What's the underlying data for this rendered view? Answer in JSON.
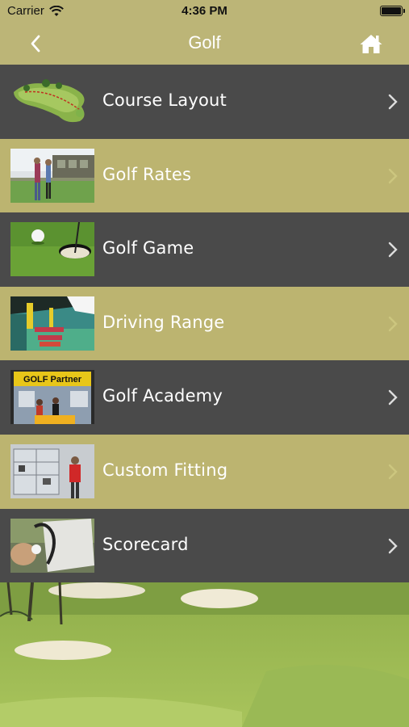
{
  "status_bar": {
    "carrier": "Carrier",
    "time": "4:36 PM"
  },
  "nav": {
    "title": "Golf",
    "back_icon": "chevron-left-icon",
    "home_icon": "home-icon"
  },
  "menu": {
    "items": [
      {
        "label": "Course Layout",
        "thumb": "course-layout-thumbnail",
        "style": "dark"
      },
      {
        "label": "Golf Rates",
        "thumb": "golf-rates-thumbnail",
        "style": "light"
      },
      {
        "label": "Golf Game",
        "thumb": "golf-game-thumbnail",
        "style": "dark"
      },
      {
        "label": "Driving Range",
        "thumb": "driving-range-thumbnail",
        "style": "light"
      },
      {
        "label": "Golf Academy",
        "thumb": "golf-academy-thumbnail",
        "style": "dark",
        "sign_text": "GOLF Partner"
      },
      {
        "label": "Custom Fitting",
        "thumb": "custom-fitting-thumbnail",
        "style": "light"
      },
      {
        "label": "Scorecard",
        "thumb": "scorecard-thumbnail",
        "style": "dark"
      }
    ]
  },
  "colors": {
    "nav_background": "#bcb577",
    "row_dark": "#4a4a4a",
    "row_light": "#bcb470",
    "text_on_rows": "#ffffff"
  }
}
